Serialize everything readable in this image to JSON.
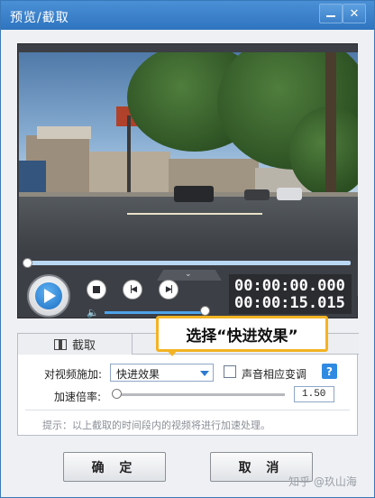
{
  "window": {
    "title": "预览/截取",
    "minimize_glyph": "—",
    "close_glyph": "✕"
  },
  "player": {
    "current_time": "00:00:00.000",
    "total_time": "00:00:15.015",
    "seek_progress": 0.0,
    "volume_level": 0.95,
    "icons": [
      "play-icon",
      "stop-icon",
      "prev-frame-icon",
      "next-frame-icon",
      "volume-icon",
      "collapse-chevron-icon"
    ]
  },
  "panel": {
    "tab_label": "截取",
    "apply_label": "对视频施加:",
    "effect_value": "快进效果",
    "pitch_label": "声音相应变调",
    "pitch_checked": false,
    "help_glyph": "?",
    "rate_label": "加速倍率:",
    "rate_value": "1.50",
    "hint": "提示：以上截取的时间段内的视频将进行加速处理。"
  },
  "callout": {
    "text": "选择“快进效果”",
    "color": "#f3b323"
  },
  "buttons": {
    "ok": "确 定",
    "cancel": "取 消"
  },
  "watermark": "知乎 @玖山海",
  "colors": {
    "title_bar": "#2f74bf",
    "accent": "#2d7bd0"
  }
}
